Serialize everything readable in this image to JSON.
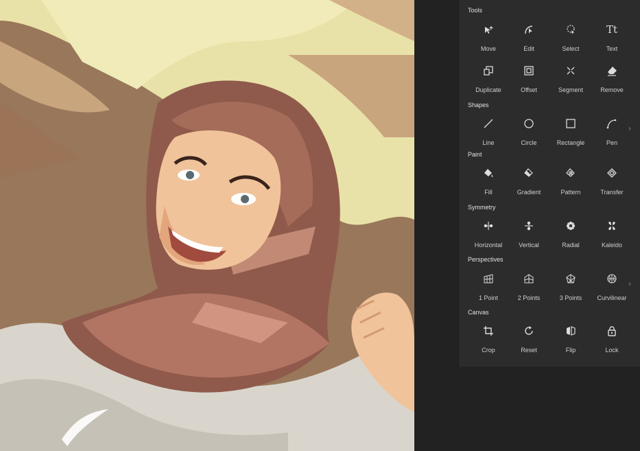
{
  "panel": {
    "sections": [
      {
        "title": "Tools",
        "items": [
          {
            "label": "Move",
            "icon": "move-icon"
          },
          {
            "label": "Edit",
            "icon": "edit-node-icon"
          },
          {
            "label": "Select",
            "icon": "lasso-select-icon"
          },
          {
            "label": "Text",
            "icon": "text-icon",
            "glyph": "Tt"
          },
          {
            "label": "Duplicate",
            "icon": "duplicate-icon"
          },
          {
            "label": "Offset",
            "icon": "offset-icon"
          },
          {
            "label": "Segment",
            "icon": "segment-icon"
          },
          {
            "label": "Remove",
            "icon": "eraser-icon"
          }
        ]
      },
      {
        "title": "Shapes",
        "items": [
          {
            "label": "Line",
            "icon": "line-icon"
          },
          {
            "label": "Circle",
            "icon": "circle-icon"
          },
          {
            "label": "Rectangle",
            "icon": "rectangle-icon"
          },
          {
            "label": "Pen",
            "icon": "pen-curve-icon"
          }
        ]
      },
      {
        "title": "Paint",
        "items": [
          {
            "label": "Fill",
            "icon": "fill-bucket-icon"
          },
          {
            "label": "Gradient",
            "icon": "gradient-icon"
          },
          {
            "label": "Pattern",
            "icon": "pattern-icon"
          },
          {
            "label": "Transfer",
            "icon": "transfer-icon"
          }
        ]
      },
      {
        "title": "Symmetry",
        "items": [
          {
            "label": "Horizontal",
            "icon": "horizontal-symmetry-icon"
          },
          {
            "label": "Vertical",
            "icon": "vertical-symmetry-icon"
          },
          {
            "label": "Radial",
            "icon": "radial-symmetry-icon"
          },
          {
            "label": "Kaleido",
            "icon": "kaleido-icon"
          }
        ]
      },
      {
        "title": "Perspectives",
        "items": [
          {
            "label": "1 Point",
            "icon": "one-point-perspective-icon"
          },
          {
            "label": "2 Points",
            "icon": "two-point-perspective-icon"
          },
          {
            "label": "3 Points",
            "icon": "three-point-perspective-icon"
          },
          {
            "label": "Curvilinear",
            "icon": "curvilinear-icon"
          }
        ]
      },
      {
        "title": "Canvas",
        "items": [
          {
            "label": "Crop",
            "icon": "crop-icon"
          },
          {
            "label": "Reset",
            "icon": "reset-icon"
          },
          {
            "label": "Flip",
            "icon": "flip-icon"
          },
          {
            "label": "Lock",
            "icon": "lock-icon"
          }
        ]
      }
    ],
    "more_glyph": "›"
  },
  "colors": {
    "panel_bg": "#2c2c2c",
    "app_bg": "#222222",
    "icon": "#dcdcdc",
    "label": "#cfcfcf"
  }
}
